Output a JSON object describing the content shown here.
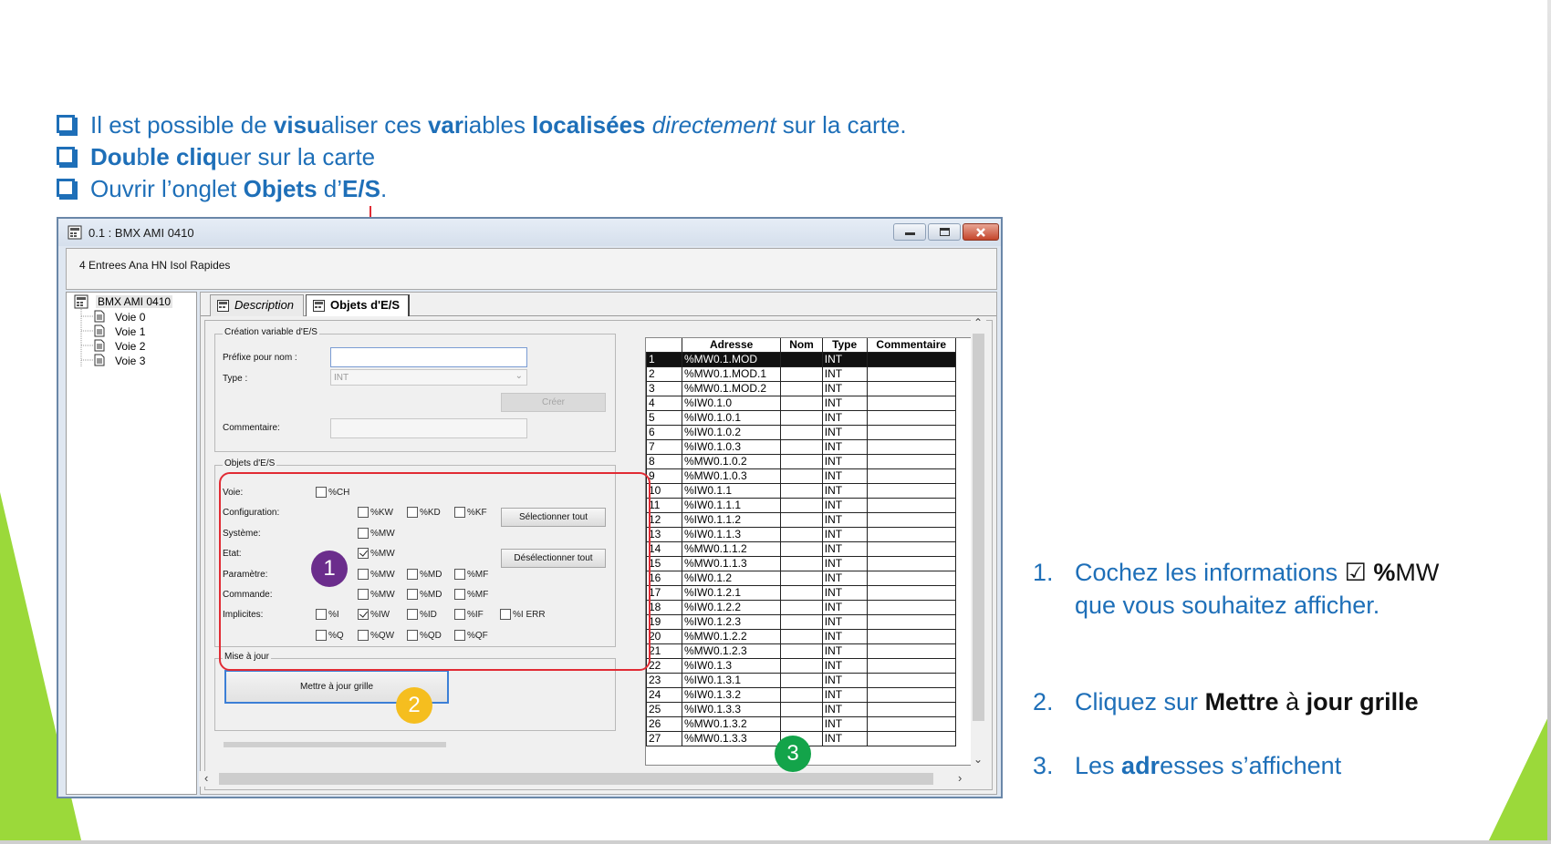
{
  "slide": {
    "bullets": [
      {
        "parts": [
          [
            "n",
            "Il est possible de "
          ],
          [
            "b",
            "visu"
          ],
          [
            "n",
            "aliser ces "
          ],
          [
            "b",
            "var"
          ],
          [
            "n",
            "iables "
          ],
          [
            "b",
            "localisées"
          ],
          [
            "n",
            " "
          ],
          [
            "i",
            "directement"
          ],
          [
            "n",
            " sur la carte."
          ]
        ]
      },
      {
        "parts": [
          [
            "b",
            "Dou"
          ],
          [
            "n",
            "b"
          ],
          [
            "b",
            "le"
          ],
          [
            "n",
            " "
          ],
          [
            "b",
            "cliq"
          ],
          [
            "n",
            "uer sur la carte"
          ]
        ]
      },
      {
        "parts": [
          [
            "n",
            "Ouvrir l’onglet "
          ],
          [
            "b",
            "Objets"
          ],
          [
            "n",
            " d’"
          ],
          [
            "b",
            "E/S"
          ],
          [
            "n",
            "."
          ]
        ]
      }
    ],
    "steps": [
      {
        "num": "1.",
        "line1_a": "Cochez les informations",
        "line1_check": "☑",
        "line1_pct": "%",
        "line1_b": "MW",
        "line2": "que vous souhaitez afficher."
      },
      {
        "num": "2.",
        "a": "Cliquez sur ",
        "b": "Mettre",
        "c": " à ",
        "d": "jour grille"
      },
      {
        "num": "3.",
        "a": "Les ",
        "b": "adr",
        "c": "esses s’affichent"
      }
    ],
    "callouts": {
      "one": "1",
      "two": "2",
      "three": "3"
    },
    "colors": {
      "text_blue": "#1e6fb8",
      "red_box": "#e12b34",
      "callout_purple": "#6b2d8c",
      "callout_yellow": "#f5be1f",
      "callout_green": "#13a44a",
      "deco_green": "#9bd93a"
    }
  },
  "window": {
    "title": "0.1 : BMX AMI 0410",
    "subtitle": "4 Entrees Ana HN Isol Rapides",
    "tree": {
      "root": "BMX AMI 0410",
      "children": [
        "Voie 0",
        "Voie 1",
        "Voie 2",
        "Voie 3"
      ]
    },
    "tabs": {
      "description": "Description",
      "objets": "Objets d'E/S"
    },
    "creation": {
      "group_title": "Création variable d'E/S",
      "prefix_label": "Préfixe pour nom :",
      "type_label": "Type :",
      "type_value": "INT",
      "create_button": "Créer",
      "comment_label": "Commentaire:"
    },
    "objects": {
      "group_title": "Objets d'E/S",
      "labels": {
        "voie": "Voie:",
        "config": "Configuration:",
        "systeme": "Système:",
        "etat": "Etat:",
        "parametre": "Paramètre:",
        "commande": "Commande:",
        "implicites": "Implicites:"
      },
      "cb": {
        "ch": "%CH",
        "kw": "%KW",
        "kd": "%KD",
        "kf": "%KF",
        "sys_mw": "%MW",
        "etat_mw": "%MW",
        "par_mw": "%MW",
        "par_md": "%MD",
        "par_mf": "%MF",
        "cmd_mw": "%MW",
        "cmd_md": "%MD",
        "cmd_mf": "%MF",
        "i": "%I",
        "iw": "%IW",
        "id": "%ID",
        "if": "%IF",
        "ierr": "%I ERR",
        "q": "%Q",
        "qw": "%QW",
        "qd": "%QD",
        "qf": "%QF"
      },
      "select_all": "Sélectionner tout",
      "deselect_all": "Désélectionner tout"
    },
    "update": {
      "group_title": "Mise à jour",
      "button": "Mettre à jour grille"
    },
    "grid": {
      "headers": [
        "",
        "Adresse",
        "Nom",
        "Type",
        "Commentaire"
      ],
      "rows": [
        [
          "1",
          "%MW0.1.MOD",
          "",
          "INT",
          ""
        ],
        [
          "2",
          "%MW0.1.MOD.1",
          "",
          "INT",
          ""
        ],
        [
          "3",
          "%MW0.1.MOD.2",
          "",
          "INT",
          ""
        ],
        [
          "4",
          "%IW0.1.0",
          "",
          "INT",
          ""
        ],
        [
          "5",
          "%IW0.1.0.1",
          "",
          "INT",
          ""
        ],
        [
          "6",
          "%IW0.1.0.2",
          "",
          "INT",
          ""
        ],
        [
          "7",
          "%IW0.1.0.3",
          "",
          "INT",
          ""
        ],
        [
          "8",
          "%MW0.1.0.2",
          "",
          "INT",
          ""
        ],
        [
          "9",
          "%MW0.1.0.3",
          "",
          "INT",
          ""
        ],
        [
          "10",
          "%IW0.1.1",
          "",
          "INT",
          ""
        ],
        [
          "11",
          "%IW0.1.1.1",
          "",
          "INT",
          ""
        ],
        [
          "12",
          "%IW0.1.1.2",
          "",
          "INT",
          ""
        ],
        [
          "13",
          "%IW0.1.1.3",
          "",
          "INT",
          ""
        ],
        [
          "14",
          "%MW0.1.1.2",
          "",
          "INT",
          ""
        ],
        [
          "15",
          "%MW0.1.1.3",
          "",
          "INT",
          ""
        ],
        [
          "16",
          "%IW0.1.2",
          "",
          "INT",
          ""
        ],
        [
          "17",
          "%IW0.1.2.1",
          "",
          "INT",
          ""
        ],
        [
          "18",
          "%IW0.1.2.2",
          "",
          "INT",
          ""
        ],
        [
          "19",
          "%IW0.1.2.3",
          "",
          "INT",
          ""
        ],
        [
          "20",
          "%MW0.1.2.2",
          "",
          "INT",
          ""
        ],
        [
          "21",
          "%MW0.1.2.3",
          "",
          "INT",
          ""
        ],
        [
          "22",
          "%IW0.1.3",
          "",
          "INT",
          ""
        ],
        [
          "23",
          "%IW0.1.3.1",
          "",
          "INT",
          ""
        ],
        [
          "24",
          "%IW0.1.3.2",
          "",
          "INT",
          ""
        ],
        [
          "25",
          "%IW0.1.3.3",
          "",
          "INT",
          ""
        ],
        [
          "26",
          "%MW0.1.3.2",
          "",
          "INT",
          ""
        ],
        [
          "27",
          "%MW0.1.3.3",
          "",
          "INT",
          ""
        ]
      ],
      "selected_row": 1
    }
  }
}
